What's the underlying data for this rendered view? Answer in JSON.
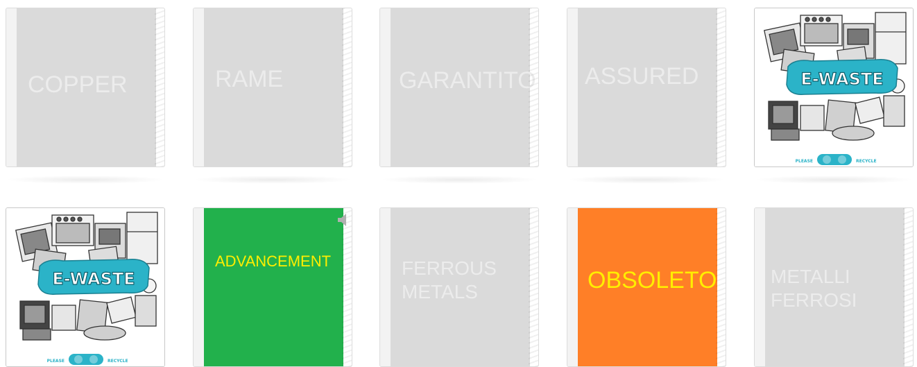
{
  "cards": [
    {
      "id": "copper",
      "text": "COPPER",
      "state": "face-down"
    },
    {
      "id": "rame",
      "text": "RAME",
      "state": "face-down"
    },
    {
      "id": "garantito",
      "text": "GARANTITO",
      "state": "face-down"
    },
    {
      "id": "assured",
      "text": "ASSURED",
      "state": "face-down"
    },
    {
      "id": "ewaste-1",
      "title": "E-WASTE",
      "left_word": "PLEASE",
      "right_word": "RECYCLE",
      "state": "revealed"
    },
    {
      "id": "ewaste-2",
      "title": "E-WASTE",
      "left_word": "PLEASE",
      "right_word": "RECYCLE",
      "state": "revealed"
    },
    {
      "id": "advancement",
      "text": "ADVANCEMENT",
      "state": "face-up",
      "color": "#22b14c"
    },
    {
      "id": "ferrous",
      "line1": "FERROUS",
      "line2": "METALS",
      "state": "face-down"
    },
    {
      "id": "obsoleto",
      "text": "OBSOLETO",
      "state": "face-up",
      "color": "#ff7f27"
    },
    {
      "id": "metalli",
      "line1": "METALLI",
      "line2": "FERROSI",
      "state": "face-down"
    }
  ],
  "colors": {
    "grey_face": "#dadada",
    "green_face": "#22b14c",
    "orange_face": "#ff7f27",
    "highlight_text": "#ffee00",
    "ewaste_teal": "#2bb3c8"
  },
  "icons": [
    "speaker-icon",
    "recycle-icon",
    "bin-icon"
  ]
}
